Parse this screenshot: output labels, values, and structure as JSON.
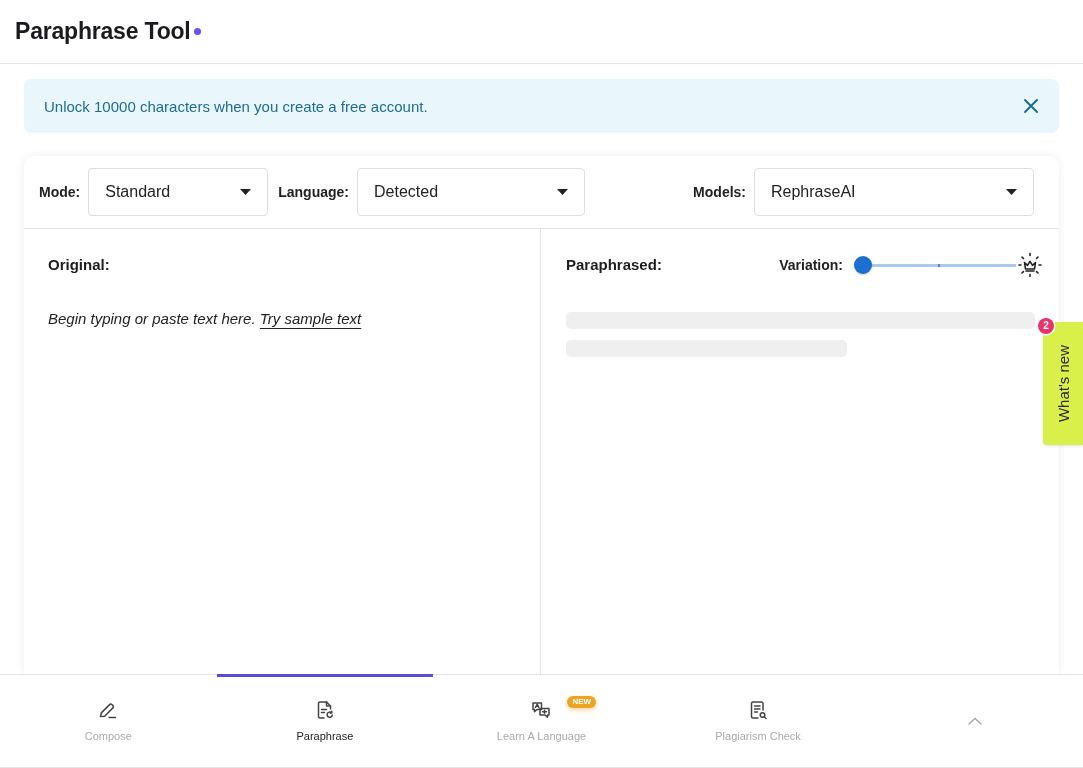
{
  "header": {
    "title": "Paraphrase Tool"
  },
  "banner": {
    "message": "Unlock 10000 characters when you create a free account."
  },
  "toolbar": {
    "mode": {
      "label": "Mode:",
      "value": "Standard"
    },
    "language": {
      "label": "Language:",
      "value": "Detected"
    },
    "models": {
      "label": "Models:",
      "value": "RephraseAI"
    }
  },
  "original": {
    "heading": "Original:",
    "placeholder": "Begin typing or paste text here.",
    "sample_link": "Try sample text"
  },
  "paraphrased": {
    "heading": "Paraphrased:",
    "variation": {
      "label": "Variation:",
      "level": 0
    }
  },
  "whats_new": {
    "label": "What's new",
    "count": "2"
  },
  "bottom_nav": [
    {
      "label": "Compose",
      "selected": false
    },
    {
      "label": "Paraphrase",
      "selected": true
    },
    {
      "label": "Learn A Language",
      "selected": false,
      "badge": "NEW"
    },
    {
      "label": "Plagiarism Check",
      "selected": false
    }
  ]
}
